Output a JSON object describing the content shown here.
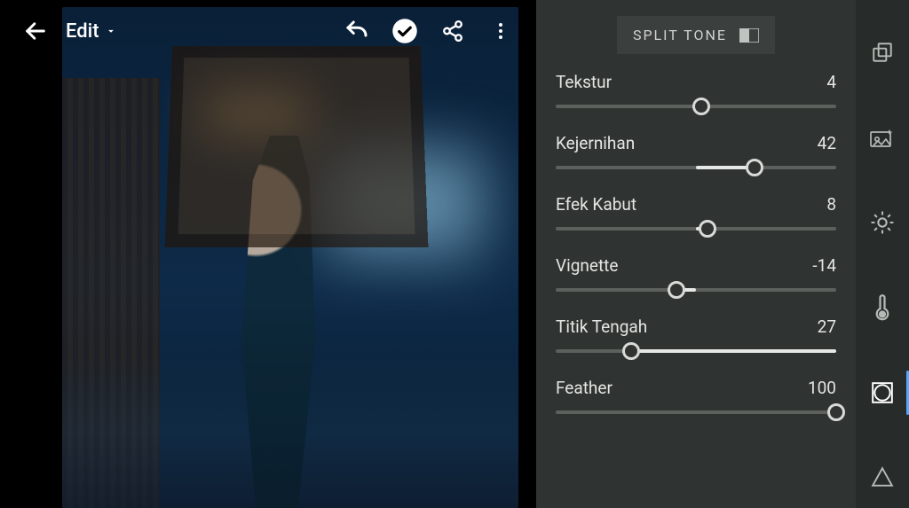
{
  "header": {
    "edit_label": "Edit"
  },
  "section": {
    "title": "SPLIT TONE"
  },
  "sliders": [
    {
      "label": "Tekstur",
      "value": 4,
      "min": -100,
      "max": 100,
      "mode": "bipolar"
    },
    {
      "label": "Kejernihan",
      "value": 42,
      "min": -100,
      "max": 100,
      "mode": "bipolar"
    },
    {
      "label": "Efek Kabut",
      "value": 8,
      "min": -100,
      "max": 100,
      "mode": "bipolar"
    },
    {
      "label": "Vignette",
      "value": -14,
      "min": -100,
      "max": 100,
      "mode": "bipolar"
    },
    {
      "label": "Titik Tengah",
      "value": 27,
      "min": 0,
      "max": 100,
      "mode": "right"
    },
    {
      "label": "Feather",
      "value": 100,
      "min": 0,
      "max": 100,
      "mode": "right"
    }
  ],
  "rail": {
    "active_index": 4,
    "icons": [
      "copies-icon",
      "auto-enhance-icon",
      "light-icon",
      "color-temp-icon",
      "effects-icon",
      "detail-icon"
    ]
  },
  "colors": {
    "panel_bg": "#2f3331",
    "rail_bg": "#272b29",
    "track": "#5d615e",
    "fill": "#e6e8e5",
    "accent": "#5aa7ff"
  }
}
